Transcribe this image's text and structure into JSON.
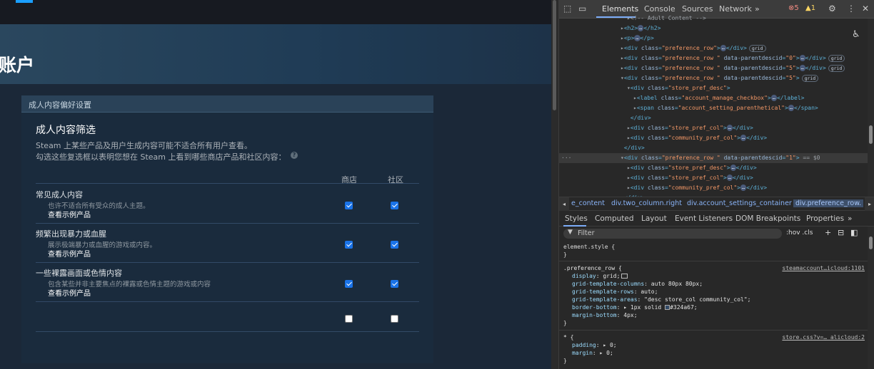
{
  "steam": {
    "page_title": "账户",
    "panel_header": "成人内容偏好设置",
    "filter_title": "成人内容筛选",
    "filter_desc1": "Steam 上某些产品及用户生成内容可能不适合所有用户查看。",
    "filter_desc2": "勾选这些复选框以表明您想在 Steam 上看到哪些商店产品和社区内容：",
    "help_icon": "?",
    "col_store": "商店",
    "col_community": "社区",
    "rows": [
      {
        "title": "常见成人内容",
        "sub": "也许不适合所有受众的成人主题。",
        "link": "查看示例产品",
        "store": true,
        "community": true
      },
      {
        "title": "频繁出现暴力或血腥",
        "sub": "展示极端暴力或血腥的游戏或内容。",
        "link": "查看示例产品",
        "store": true,
        "community": true
      },
      {
        "title": "一些裸露画面或色情内容",
        "sub": "包含某些并非主要焦点的裸露或色情主题的游戏或内容",
        "link": "查看示例产品",
        "store": true,
        "community": true
      },
      {
        "title": "",
        "sub": "",
        "link": "",
        "store": false,
        "community": false
      }
    ]
  },
  "devtools": {
    "tabs": [
      "Elements",
      "Console",
      "Sources",
      "Network"
    ],
    "more_tabs": "»",
    "errors": "5",
    "warnings": "1",
    "dom_lines": [
      {
        "i": 12,
        "t": "▸",
        "html": "<!-- Adult Content -->"
      },
      {
        "i": 11,
        "t": "▸",
        "tag": "h2"
      },
      {
        "i": 11,
        "t": "▸",
        "tag": "p"
      },
      {
        "i": 11,
        "t": "▸",
        "tag": "div",
        "cls": "preference_row",
        "pill": "grid"
      },
      {
        "i": 11,
        "t": "▸",
        "tag": "div",
        "cls": "preference_row ",
        "pid": "0",
        "pill": "grid"
      },
      {
        "i": 11,
        "t": "▸",
        "tag": "div",
        "cls": "preference_row ",
        "pid": "5",
        "pill": "grid"
      },
      {
        "i": 11,
        "t": "▾",
        "tag": "div",
        "cls": "preference_row ",
        "pid": "5",
        "open": true,
        "pill": "grid"
      },
      {
        "i": 12,
        "t": "▾",
        "tag": "div",
        "cls": "store_pref_desc",
        "open": true
      },
      {
        "i": 13,
        "t": "▸",
        "tag": "label",
        "cls": "account_manage_checkbox"
      },
      {
        "i": 13,
        "t": "▸",
        "tag": "span",
        "cls": "account_setting_parenthetical"
      },
      {
        "i": 12,
        "t": "",
        "close": "div"
      },
      {
        "i": 12,
        "t": "▸",
        "tag": "div",
        "cls": "store_pref_col"
      },
      {
        "i": 12,
        "t": "▸",
        "tag": "div",
        "cls": "community_pref_col"
      },
      {
        "i": 11,
        "t": "",
        "close": "div"
      },
      {
        "i": 11,
        "t": "▾",
        "tag": "div",
        "cls": "preference_row ",
        "pid": "1",
        "open": true,
        "selected": true,
        "eq": " == $0"
      },
      {
        "i": 12,
        "t": "▸",
        "tag": "div",
        "cls": "store_pref_desc"
      },
      {
        "i": 12,
        "t": "▸",
        "tag": "div",
        "cls": "store_pref_col"
      },
      {
        "i": 12,
        "t": "▸",
        "tag": "div",
        "cls": "community_pref_col"
      },
      {
        "i": 11,
        "t": "",
        "close": "div"
      }
    ],
    "breadcrumbs": [
      "e_content",
      "div.two_column.right",
      "div.account_settings_container",
      "div.preference_row."
    ],
    "style_tabs": [
      "Styles",
      "Computed",
      "Layout",
      "Event Listeners",
      "DOM Breakpoints",
      "Properties"
    ],
    "filter_placeholder": "Filter",
    "hov_cls": ":hov  .cls",
    "element_style": "element.style {",
    "rule1": {
      "selector": ".preference_row {",
      "source": "steamaccount…icloud:1101",
      "props": [
        {
          "p": "display",
          "v": "grid;"
        },
        {
          "p": "grid-template-columns",
          "v": "auto 80px 80px;"
        },
        {
          "p": "grid-template-rows",
          "v": "auto;"
        },
        {
          "p": "grid-template-areas",
          "v": "\"desc store_col community_col\";"
        },
        {
          "p": "border-bottom",
          "v": "▸ 1px solid",
          "v2": "#324a67;"
        },
        {
          "p": "margin-bottom",
          "v": "4px;"
        }
      ]
    },
    "rule2": {
      "selector": "* {",
      "source": "store.css?v=…_alicloud:2",
      "props": [
        {
          "p": "padding",
          "v": "▸ 0;"
        },
        {
          "p": "margin",
          "v": "▸ 0;"
        }
      ]
    }
  }
}
